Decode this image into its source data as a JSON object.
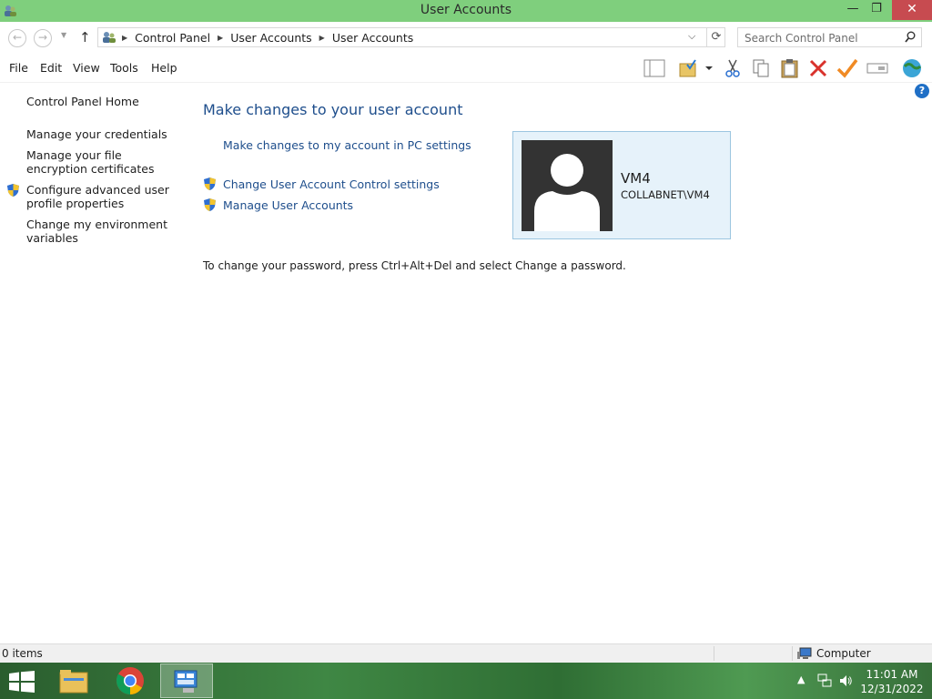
{
  "window": {
    "title": "User Accounts",
    "minimize_glyph": "—",
    "maximize_glyph": "❐",
    "close_glyph": "✕"
  },
  "address_bar": {
    "breadcrumbs": [
      "Control Panel",
      "User Accounts",
      "User Accounts"
    ],
    "search_placeholder": "Search Control Panel"
  },
  "menu": [
    "File",
    "Edit",
    "View",
    "Tools",
    "Help"
  ],
  "toolbar_icons": [
    "layout-pane-icon",
    "folder-check-icon",
    "dropdown-arrow-icon",
    "cut-icon",
    "copy-icon",
    "paste-icon",
    "delete-icon",
    "checkmark-icon",
    "rename-icon",
    "globe-icon"
  ],
  "sidebar": {
    "items": [
      {
        "label": "Control Panel Home"
      },
      {
        "label": "Manage your credentials"
      },
      {
        "label": "Manage your file encryption certificates"
      },
      {
        "label": "Configure advanced user profile properties",
        "shield": true
      },
      {
        "label": "Change my environment variables"
      }
    ]
  },
  "main": {
    "heading": "Make changes to your user account",
    "link_pc_settings": "Make changes to my account in PC settings",
    "link_uac": "Change User Account Control settings",
    "link_manage": "Manage User Accounts",
    "note": "To change your password, press Ctrl+Alt+Del and select Change a password."
  },
  "account": {
    "name": "VM4",
    "domain": "COLLABNET\\VM4"
  },
  "status": {
    "items_count": "0 items",
    "location": "Computer"
  },
  "taskbar": {
    "apps": [
      "file-explorer",
      "chrome",
      "control-panel"
    ],
    "active_app": "control-panel",
    "time": "11:01 AM",
    "date": "12/31/2022"
  },
  "colors": {
    "titlebar": "#7fcf7d",
    "link": "#1e4e8c",
    "tile_bg": "#e6f2fa",
    "close_button": "#c74b50"
  }
}
